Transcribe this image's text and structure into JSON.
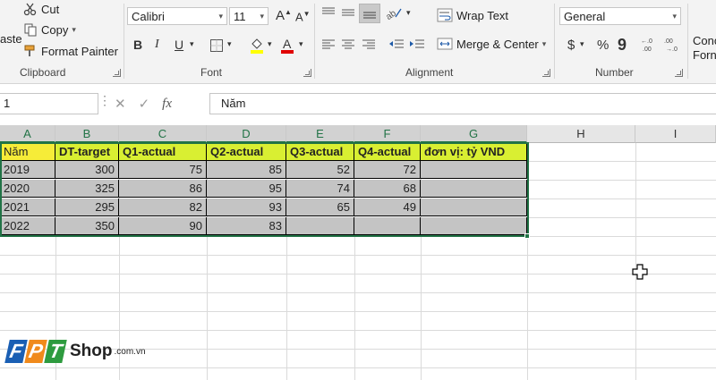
{
  "clipboard": {
    "paste_label": "aste",
    "cut_label": "Cut",
    "copy_label": "Copy",
    "format_painter_label": "Format Painter",
    "group_label": "Clipboard"
  },
  "font": {
    "name": "Calibri",
    "size": "11",
    "bold": "B",
    "italic": "I",
    "underline": "U",
    "group_label": "Font"
  },
  "alignment": {
    "wrap_text_label": "Wrap Text",
    "merge_center_label": "Merge & Center",
    "group_label": "Alignment"
  },
  "number": {
    "format": "General",
    "currency": "$",
    "percent": "%",
    "comma": "9",
    "group_label": "Number"
  },
  "styles": {
    "cond_label_1": "Conc",
    "cond_label_2": "Forn"
  },
  "formula_bar": {
    "name_box": "1",
    "fx": "fx",
    "content": "Năm"
  },
  "columns": [
    "A",
    "B",
    "C",
    "D",
    "E",
    "F",
    "G",
    "H",
    "I"
  ],
  "table": {
    "headers": [
      "Năm",
      "DT-target",
      "Q1-actual",
      "Q2-actual",
      "Q3-actual",
      "Q4-actual",
      "đơn vị: tỷ VND"
    ],
    "rows": [
      [
        "2019",
        "300",
        "75",
        "85",
        "52",
        "72",
        ""
      ],
      [
        "2020",
        "325",
        "86",
        "95",
        "74",
        "68",
        ""
      ],
      [
        "2021",
        "295",
        "82",
        "93",
        "65",
        "49",
        ""
      ],
      [
        "2022",
        "350",
        "90",
        "83",
        "",
        "",
        ""
      ]
    ]
  },
  "watermark": {
    "letters": [
      "F",
      "P",
      "T"
    ],
    "brand": "Shop",
    "domain": ".com.vn"
  },
  "colors": {
    "accent": "#217346",
    "header_fill": "#d9ef32",
    "year_header_fill": "#f6ec38",
    "body_fill": "#c4c4c4",
    "logo_blue": "#1a5fb4",
    "logo_orange": "#f08a1c",
    "logo_green": "#2e9b3f"
  }
}
